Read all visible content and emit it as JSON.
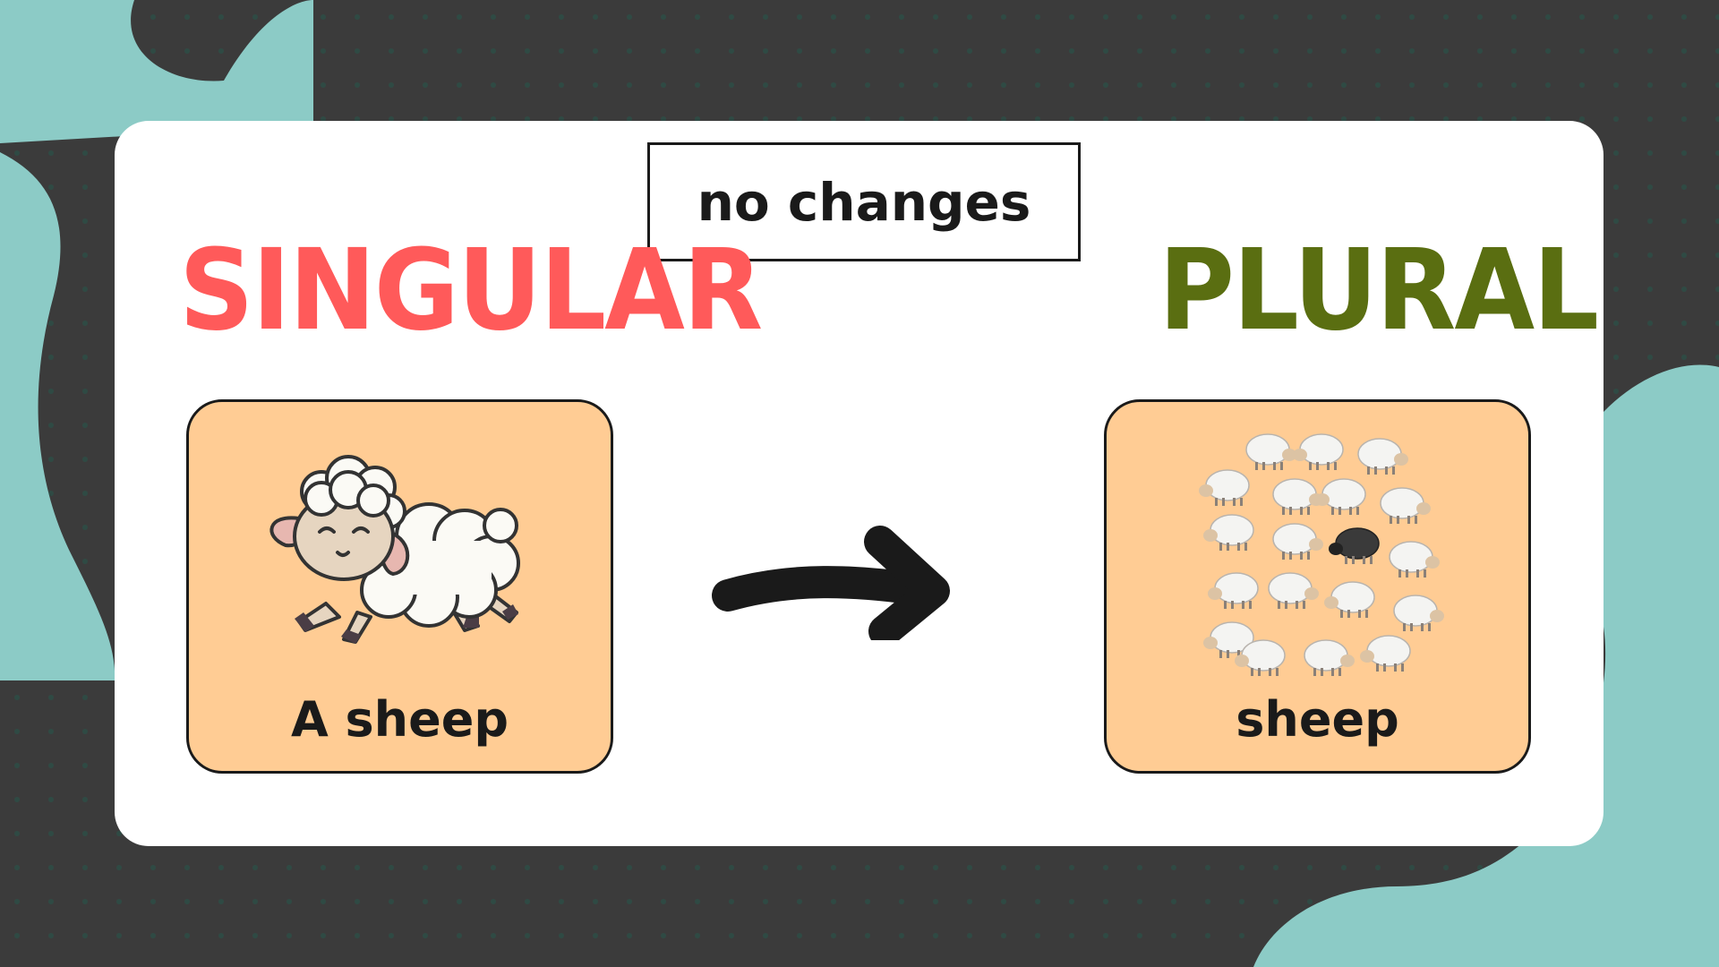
{
  "tag": {
    "text": "no changes"
  },
  "left": {
    "heading": "SINGULAR",
    "label": "A sheep"
  },
  "right": {
    "heading": "PLURAL",
    "label": "sheep"
  },
  "colors": {
    "background": "#3b3b3b",
    "blob": "#8ccbc6",
    "singular": "#ff5a5a",
    "plural": "#5a6e11",
    "panel": "#ffcc94"
  },
  "icons": [
    "sheep-icon",
    "sheep-flock-icon",
    "arrow-right-icon"
  ]
}
